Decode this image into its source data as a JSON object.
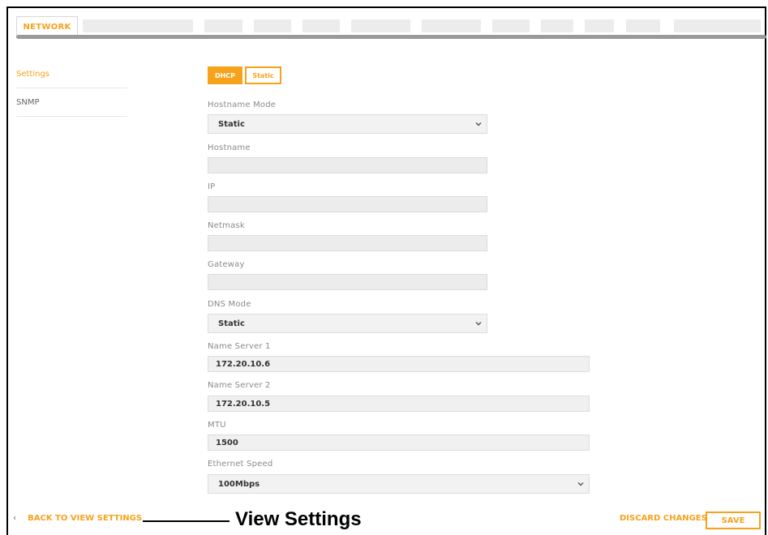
{
  "tabs": {
    "active_label": "NETWORK"
  },
  "sidebar": {
    "items": [
      {
        "label": "Settings",
        "active": true
      },
      {
        "label": "SNMP",
        "active": false
      }
    ]
  },
  "mode_toggle": {
    "dhcp_label": "DHCP",
    "static_label": "Static",
    "selected": "DHCP"
  },
  "form": {
    "hostname_mode": {
      "label": "Hostname Mode",
      "value": "Static"
    },
    "hostname": {
      "label": "Hostname",
      "value": ""
    },
    "ip": {
      "label": "IP",
      "value": ""
    },
    "netmask": {
      "label": "Netmask",
      "value": ""
    },
    "gateway": {
      "label": "Gateway",
      "value": ""
    },
    "dns_mode": {
      "label": "DNS Mode",
      "value": "Static"
    },
    "name_server_1": {
      "label": "Name Server 1",
      "value": "172.20.10.6"
    },
    "name_server_2": {
      "label": "Name Server 2",
      "value": "172.20.10.5"
    },
    "mtu": {
      "label": "MTU",
      "value": "1500"
    },
    "ethernet_speed": {
      "label": "Ethernet Speed",
      "value": "100Mbps"
    }
  },
  "footer": {
    "back_label": "BACK TO VIEW SETTINGS",
    "callout": "View Settings",
    "discard_label": "DISCARD CHANGES",
    "save_label": "SAVE"
  },
  "colors": {
    "accent": "#f7a21b"
  }
}
